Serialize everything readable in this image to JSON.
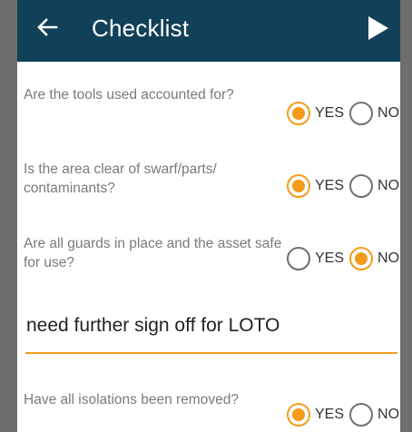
{
  "header": {
    "title": "Checklist",
    "background_color": "#114158",
    "back_icon": "arrow-left-icon",
    "next_icon": "play-icon"
  },
  "accent_color": "#f59b19",
  "questions": [
    {
      "text": "Are the tools used accounted for?",
      "yes_label": "YES",
      "no_label": "NO",
      "selected": "YES"
    },
    {
      "text": "Is the area clear of swarf/parts/ contaminants?",
      "yes_label": "YES",
      "no_label": "NO",
      "selected": "YES"
    },
    {
      "text": "Are all guards in place and the asset safe for use?",
      "yes_label": "YES",
      "no_label": "NO",
      "selected": "NO"
    },
    {
      "text": "Have all isolations been removed?",
      "yes_label": "YES",
      "no_label": "NO",
      "selected": "YES"
    }
  ],
  "comment": {
    "value": "need further sign off for LOTO"
  }
}
